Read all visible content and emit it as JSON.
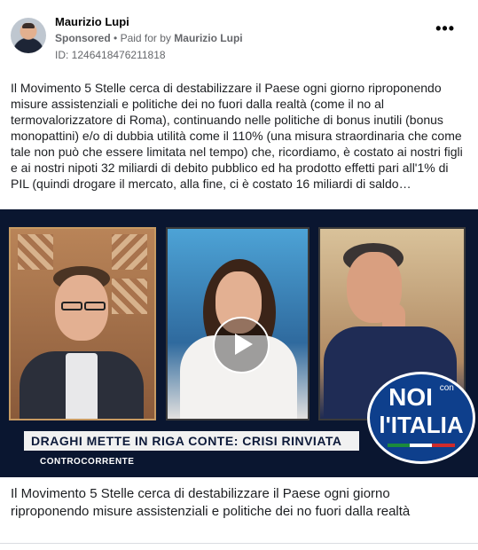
{
  "post": {
    "page_name": "Maurizio Lupi",
    "sponsored_label": "Sponsored",
    "separator": "•",
    "paid_for_label": "Paid for by",
    "paid_for_name": "Maurizio Lupi",
    "ad_id": "ID: 1246418476211818",
    "more_icon": "more-horizontal-icon",
    "body_text": "Il Movimento 5 Stelle cerca di destabilizzare il Paese ogni giorno riproponendo misure assistenziali e politiche dei no fuori dalla realtà (come il no al termovalorizzatore di Roma), continuando nelle politiche di bonus inutili (bonus monopattini) e/o di dubbia utilità come il 110% (una misura straordinaria che come tale non può che essere limitata nel tempo) che, ricordiamo, è costato ai nostri figli e ai nostri nipoti 32 miliardi di debito pubblico ed ha prodotto effetti pari all'1% di PIL (quindi drogare il mercato, alla fine, ci è costato 16 miliardi di saldo…",
    "caption": "Il Movimento 5 Stelle cerca di destabilizzare il Paese ogni giorno riproponendo misure assistenziali e politiche dei no fuori dalla realtà"
  },
  "video": {
    "banner_text": "DRAGHI METTE IN RIGA CONTE: CRISI RINVIATA",
    "channel_text": "CONTROCORRENTE",
    "logo_line1": "NOI",
    "logo_small": "con",
    "logo_line2": "l'ITALIA",
    "play_icon": "play-icon"
  }
}
